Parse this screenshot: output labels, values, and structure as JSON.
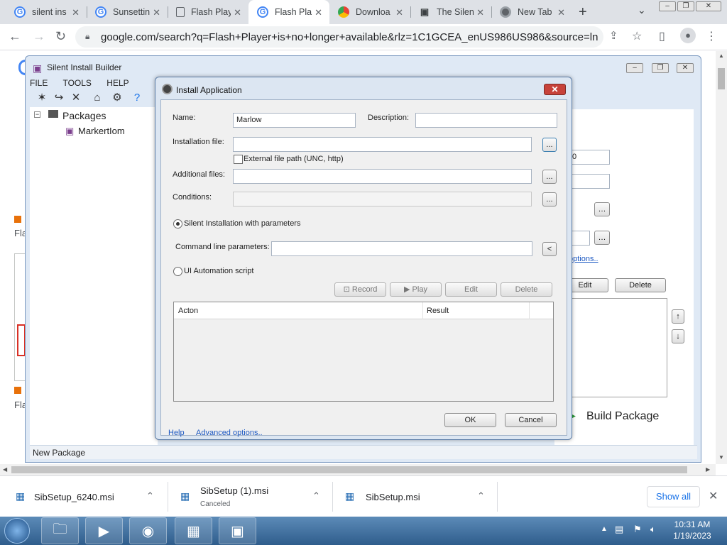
{
  "browser": {
    "tabs": [
      {
        "title": "silent ins",
        "fav": "google"
      },
      {
        "title": "Sunsettin",
        "fav": "google"
      },
      {
        "title": "Flash Play",
        "fav": "doc"
      },
      {
        "title": "Flash Pla",
        "fav": "google",
        "active": true
      },
      {
        "title": "Downloa",
        "fav": "chrome"
      },
      {
        "title": "The Silen",
        "fav": "sib"
      },
      {
        "title": "New Tab",
        "fav": "chrome"
      }
    ],
    "url": "google.com/search?q=Flash+Player+is+no+longer+available&rlz=1C1GCEA_enUS986US986&source=lnms&tb...",
    "icons": {
      "back": "back-icon",
      "forward": "forward-icon",
      "reload": "reload-icon",
      "lock": "lock-icon"
    }
  },
  "sib": {
    "title": "Silent Install Builder",
    "menu": [
      "FILE",
      "TOOLS",
      "HELP"
    ],
    "tree_root": "Packages",
    "tree_child": "MarkertIom",
    "status": "New Package",
    "build_label": "Build Package",
    "right_buttons": {
      "edit": "Edit",
      "delete": "Delete"
    },
    "options_link": "options..",
    "right_field_value": "0"
  },
  "page_fragments": {
    "left1": "Fla",
    "left2": "Fla"
  },
  "dialog": {
    "title": "Install Application",
    "name_label": "Name:",
    "name_value": "Marlow",
    "description_label": "Description:",
    "installation_file_label": "Installation file:",
    "external_path_label": "External file path (UNC, http)",
    "additional_files_label": "Additional files:",
    "conditions_label": "Conditions:",
    "silent_radio_label": "Silent Installation with parameters",
    "cmdline_label": "Command line parameters:",
    "ui_auto_label": "UI Automation script",
    "browse": "...",
    "cmd_btn": "<",
    "record": "Record",
    "play": "Play",
    "edit": "Edit",
    "delete": "Delete",
    "col_action": "Acton",
    "col_result": "Result",
    "ok": "OK",
    "cancel": "Cancel",
    "help": "Help",
    "advanced": "Advanced options.."
  },
  "downloads": [
    {
      "name": "SibSetup_6240.msi",
      "sub": ""
    },
    {
      "name": "SibSetup (1).msi",
      "sub": "Canceled"
    },
    {
      "name": "SibSetup.msi",
      "sub": ""
    }
  ],
  "downloads_show_all": "Show all",
  "taskbar": {
    "time": "10:31 AM",
    "date": "1/19/2023"
  },
  "colors": {
    "accent": "#1a73e8",
    "dialog_close": "#c7423a"
  }
}
